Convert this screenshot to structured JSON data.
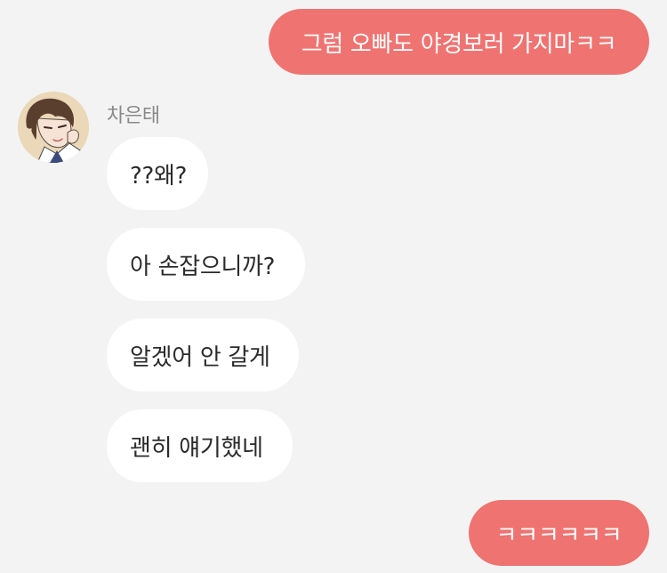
{
  "conversation": {
    "sender_name": "차은태",
    "messages": [
      {
        "direction": "outgoing",
        "text": "그럼 오빠도 야경보러 가지마ㅋㅋ"
      },
      {
        "direction": "incoming",
        "text": "??왜?"
      },
      {
        "direction": "incoming",
        "text": "아 손잡으니까?"
      },
      {
        "direction": "incoming",
        "text": "알겠어 안 갈게"
      },
      {
        "direction": "incoming",
        "text": "괜히 얘기했네"
      },
      {
        "direction": "outgoing",
        "text": "ㅋㅋㅋㅋㅋㅋ"
      }
    ]
  },
  "icons": {
    "avatar": "sender-avatar-icon"
  },
  "colors": {
    "background": "#f3f3f3",
    "outgoing_bubble": "#ef7370",
    "incoming_bubble": "#ffffff",
    "sender_name": "#8a8a8a"
  }
}
